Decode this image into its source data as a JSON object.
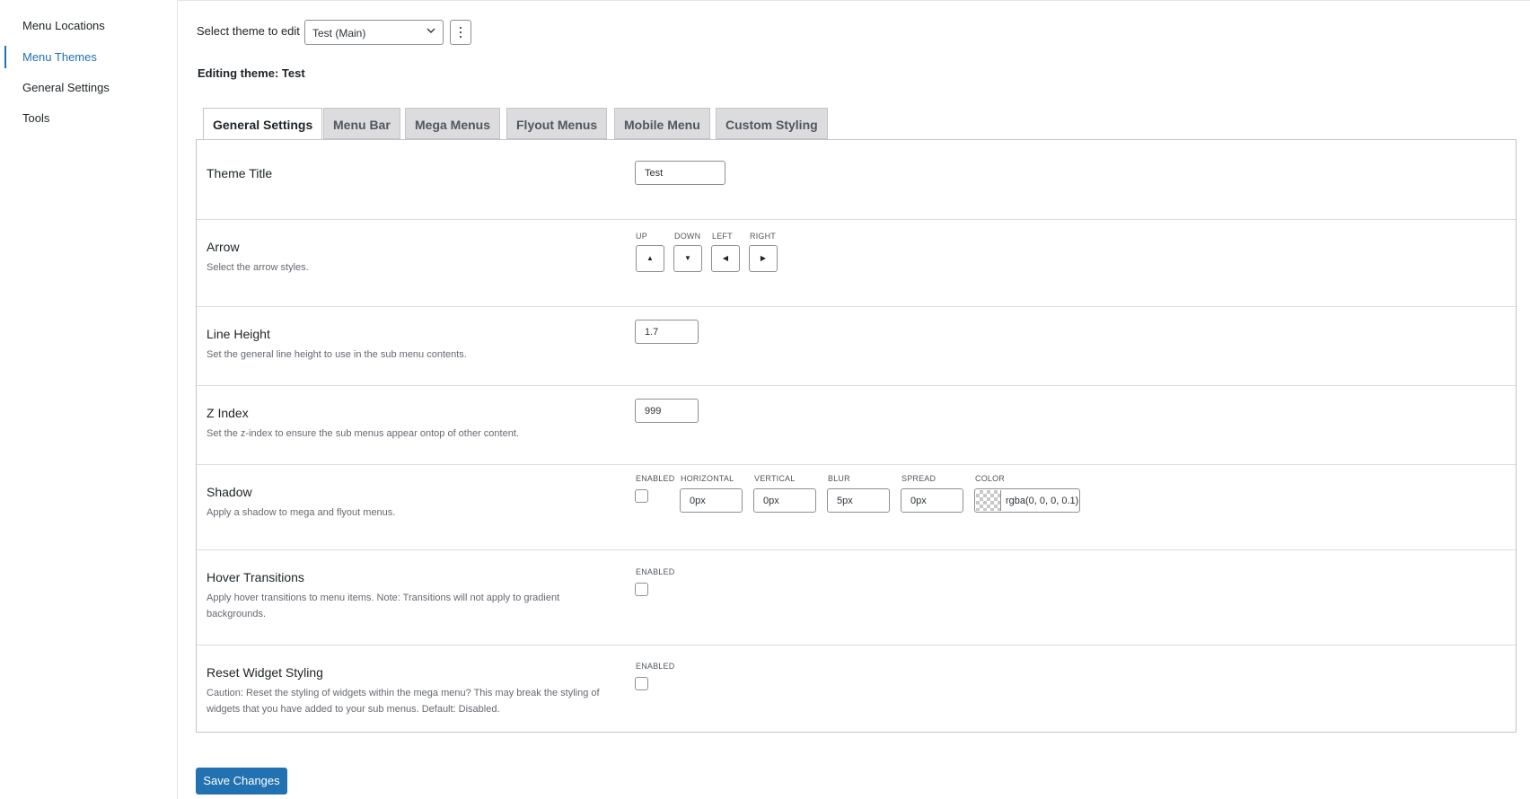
{
  "sidebar": {
    "items": [
      {
        "label": "Menu Locations"
      },
      {
        "label": "Menu Themes"
      },
      {
        "label": "General Settings"
      },
      {
        "label": "Tools"
      }
    ],
    "active_index": 1
  },
  "header": {
    "select_label": "Select theme to edit",
    "selected_theme": "Test (Main)",
    "editing_label": "Editing theme: Test"
  },
  "tabs": [
    {
      "label": "General Settings",
      "active": true
    },
    {
      "label": "Menu Bar"
    },
    {
      "label": "Mega Menus"
    },
    {
      "label": "Flyout Menus"
    },
    {
      "label": "Mobile Menu"
    },
    {
      "label": "Custom Styling"
    }
  ],
  "settings": {
    "theme_title": {
      "title": "Theme Title",
      "value": "Test"
    },
    "arrow": {
      "title": "Arrow",
      "desc": "Select the arrow styles.",
      "labels": {
        "up": "UP",
        "down": "DOWN",
        "left": "LEFT",
        "right": "RIGHT"
      },
      "icons": {
        "up": "▲",
        "down": "▼",
        "left": "◀",
        "right": "▶"
      }
    },
    "line_height": {
      "title": "Line Height",
      "desc": "Set the general line height to use in the sub menu contents.",
      "value": "1.7"
    },
    "z_index": {
      "title": "Z Index",
      "desc": "Set the z-index to ensure the sub menus appear ontop of other content.",
      "value": "999"
    },
    "shadow": {
      "title": "Shadow",
      "desc": "Apply a shadow to mega and flyout menus.",
      "labels": {
        "enabled": "ENABLED",
        "horizontal": "HORIZONTAL",
        "vertical": "VERTICAL",
        "blur": "BLUR",
        "spread": "SPREAD",
        "color": "COLOR"
      },
      "values": {
        "enabled": false,
        "horizontal": "0px",
        "vertical": "0px",
        "blur": "5px",
        "spread": "0px",
        "color": "rgba(0, 0, 0, 0.1)"
      }
    },
    "hover_transitions": {
      "title": "Hover Transitions",
      "desc": "Apply hover transitions to menu items. Note: Transitions will not apply to gradient backgrounds.",
      "enabled_label": "ENABLED",
      "enabled": false
    },
    "reset_widget": {
      "title": "Reset Widget Styling",
      "desc": "Caution: Reset the styling of widgets within the mega menu? This may break the styling of widgets that you have added to your sub menus. Default: Disabled.",
      "enabled_label": "ENABLED",
      "enabled": false
    }
  },
  "footer": {
    "save_label": "Save Changes"
  },
  "colors": {
    "accent": "#2271b1",
    "border": "#c3c4c7",
    "tab_inactive": "#dcdcde"
  }
}
